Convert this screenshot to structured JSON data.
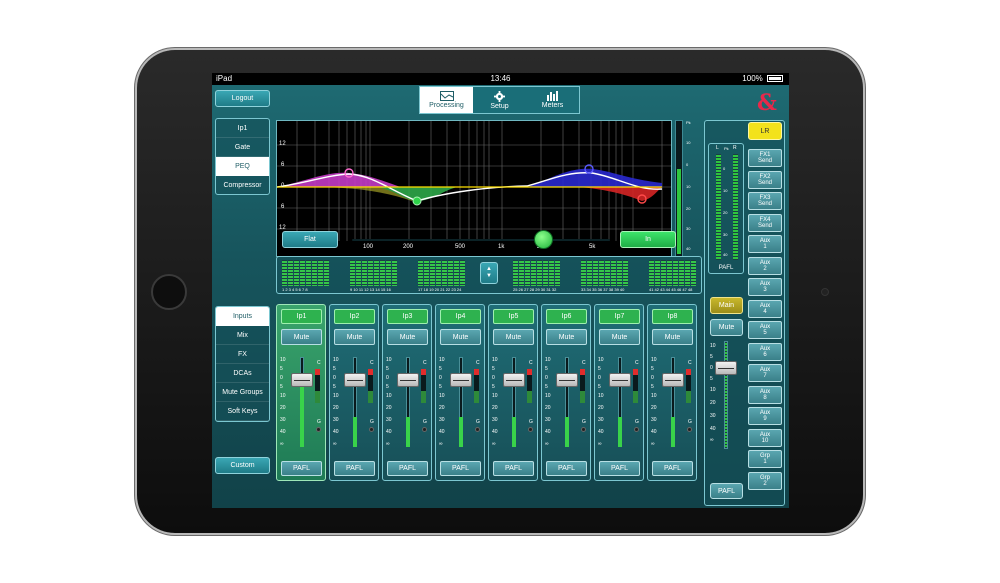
{
  "status": {
    "device": "iPad",
    "time": "13:46",
    "battery": "100%"
  },
  "toolbar": {
    "logout": "Logout",
    "tabs": [
      {
        "label": "Processing",
        "icon": "processing-icon",
        "active": true
      },
      {
        "label": "Setup",
        "icon": "gear-icon",
        "active": false
      },
      {
        "label": "Meters",
        "icon": "meters-icon",
        "active": false
      }
    ],
    "logo": "&"
  },
  "processing_menu": {
    "items": [
      "Ip1",
      "Gate",
      "PEQ",
      "Compressor"
    ],
    "active": "PEQ"
  },
  "eq": {
    "y_labels": [
      "12",
      "6",
      "0",
      "6",
      "12"
    ],
    "x_labels": [
      "50",
      "100",
      "200",
      "500",
      "1k",
      "2k",
      "5k",
      "10k"
    ],
    "meter_label": "Pk",
    "meter_scale": [
      "10",
      "0",
      "10",
      "20",
      "30",
      "40"
    ],
    "flat": "Flat",
    "in": "In"
  },
  "banks": [
    {
      "channels": "1 2 3 4 5 6 7 8"
    },
    {
      "channels": "9 10 11 12 13 14 15 16"
    },
    {
      "channels": "17 18 19 20 21 22 23 24"
    },
    {
      "channels": "25 26 27 28 29 30 31 32"
    },
    {
      "channels": "33 34 35 36 37 38 39 40"
    },
    {
      "channels": "41 42 43 44 45 46 47 48"
    }
  ],
  "nav_menu": {
    "items": [
      "Inputs",
      "Mix",
      "FX",
      "DCAs",
      "Mute Groups",
      "Soft Keys"
    ],
    "active": "Inputs",
    "custom": "Custom"
  },
  "channels": [
    {
      "name": "Ip1",
      "mute": "Mute",
      "pafl": "PAFL",
      "selected": true
    },
    {
      "name": "Ip2",
      "mute": "Mute",
      "pafl": "PAFL",
      "selected": false
    },
    {
      "name": "Ip3",
      "mute": "Mute",
      "pafl": "PAFL",
      "selected": false
    },
    {
      "name": "Ip4",
      "mute": "Mute",
      "pafl": "PAFL",
      "selected": false
    },
    {
      "name": "Ip5",
      "mute": "Mute",
      "pafl": "PAFL",
      "selected": false
    },
    {
      "name": "Ip6",
      "mute": "Mute",
      "pafl": "PAFL",
      "selected": false
    },
    {
      "name": "Ip7",
      "mute": "Mute",
      "pafl": "PAFL",
      "selected": false
    },
    {
      "name": "Ip8",
      "mute": "Mute",
      "pafl": "PAFL",
      "selected": false
    }
  ],
  "fader_scale": [
    "10",
    "5",
    "0",
    "5",
    "10",
    "20",
    "30",
    "40",
    "∞"
  ],
  "clip_labels": {
    "c": "C",
    "g": "G"
  },
  "master": {
    "lr": "LR",
    "meter_l": "L",
    "meter_r": "R",
    "meter_pk": "Pk",
    "meter_scale": [
      "0",
      "10",
      "20",
      "30",
      "40"
    ],
    "pafl_top": "PAFL",
    "main": "Main",
    "mute": "Mute",
    "pafl": "PAFL"
  },
  "sends": [
    {
      "line1": "FX1",
      "line2": "Send"
    },
    {
      "line1": "FX2",
      "line2": "Send"
    },
    {
      "line1": "FX3",
      "line2": "Send"
    },
    {
      "line1": "FX4",
      "line2": "Send"
    },
    {
      "line1": "Aux",
      "line2": "1"
    },
    {
      "line1": "Aux",
      "line2": "2"
    },
    {
      "line1": "Aux",
      "line2": "3"
    },
    {
      "line1": "Aux",
      "line2": "4"
    },
    {
      "line1": "Aux",
      "line2": "5"
    },
    {
      "line1": "Aux",
      "line2": "6"
    },
    {
      "line1": "Aux",
      "line2": "7"
    },
    {
      "line1": "Aux",
      "line2": "8"
    },
    {
      "line1": "Aux",
      "line2": "9"
    },
    {
      "line1": "Aux",
      "line2": "10"
    },
    {
      "line1": "Grp",
      "line2": "1"
    },
    {
      "line1": "Grp",
      "line2": "2"
    }
  ]
}
